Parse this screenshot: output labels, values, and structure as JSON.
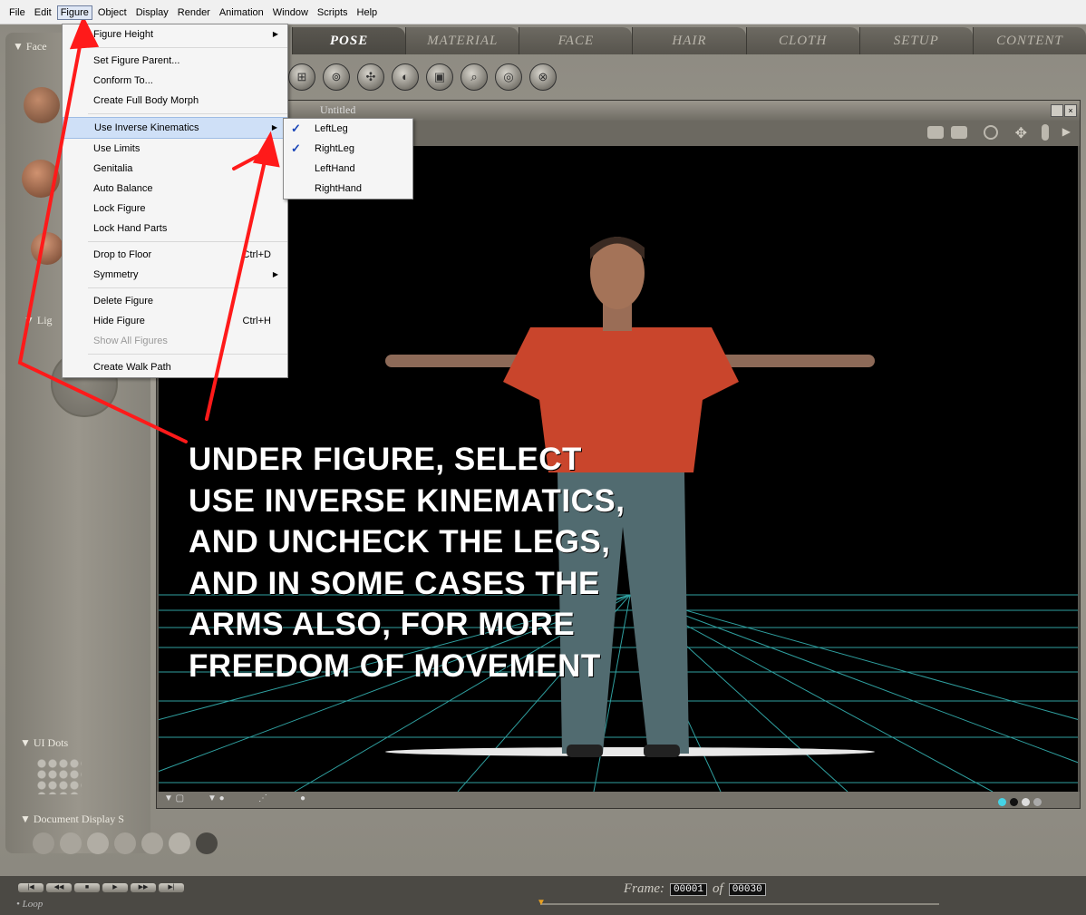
{
  "menubar": {
    "items": [
      "File",
      "Edit",
      "Figure",
      "Object",
      "Display",
      "Render",
      "Animation",
      "Window",
      "Scripts",
      "Help"
    ],
    "active": "Figure"
  },
  "tabs": [
    "POSE",
    "MATERIAL",
    "FACE",
    "HAIR",
    "CLOTH",
    "SETUP",
    "CONTENT"
  ],
  "active_tab": "POSE",
  "left_panel": {
    "face_header": "Face",
    "lights_header": "Lig",
    "ui_dots_header": "UI Dots",
    "doc_display_header": "Document Display S"
  },
  "document": {
    "title": "Untitled"
  },
  "figure_menu": {
    "items": [
      {
        "label": "Figure Height",
        "submenu": true
      },
      {
        "sep": true
      },
      {
        "label": "Set Figure Parent..."
      },
      {
        "label": "Conform To..."
      },
      {
        "label": "Create Full Body Morph"
      },
      {
        "sep": true
      },
      {
        "label": "Use Inverse Kinematics",
        "submenu": true,
        "highlight": true
      },
      {
        "label": "Use Limits"
      },
      {
        "label": "Genitalia"
      },
      {
        "label": "Auto Balance"
      },
      {
        "label": "Lock Figure"
      },
      {
        "label": "Lock Hand Parts"
      },
      {
        "sep": true
      },
      {
        "label": "Drop to Floor",
        "shortcut": "Ctrl+D"
      },
      {
        "label": "Symmetry",
        "submenu": true
      },
      {
        "sep": true
      },
      {
        "label": "Delete Figure"
      },
      {
        "label": "Hide Figure",
        "shortcut": "Ctrl+H"
      },
      {
        "label": "Show All Figures",
        "disabled": true
      },
      {
        "sep": true
      },
      {
        "label": "Create Walk Path"
      }
    ]
  },
  "ik_submenu": {
    "items": [
      {
        "label": "LeftLeg",
        "checked": true
      },
      {
        "label": "RightLeg",
        "checked": true
      },
      {
        "label": "LeftHand",
        "checked": false
      },
      {
        "label": "RightHand",
        "checked": false
      }
    ]
  },
  "annotation": {
    "lines": [
      "UNDER FIGURE, SELECT",
      "USE INVERSE KINEMATICS,",
      "AND UNCHECK THE LEGS,",
      "AND IN SOME CASES THE",
      "ARMS ALSO, FOR MORE",
      "FREEDOM OF MOVEMENT"
    ],
    "arrow_color": "#ff1a1a"
  },
  "timeline": {
    "frame_label": "Frame:",
    "current_frame": "00001",
    "of_label": "of",
    "total_frames": "00030",
    "loop_label": "Loop"
  },
  "colors": {
    "menu_highlight": "#cfe0f7",
    "check": "#1a45b8",
    "grid": "#2fa0a0"
  }
}
